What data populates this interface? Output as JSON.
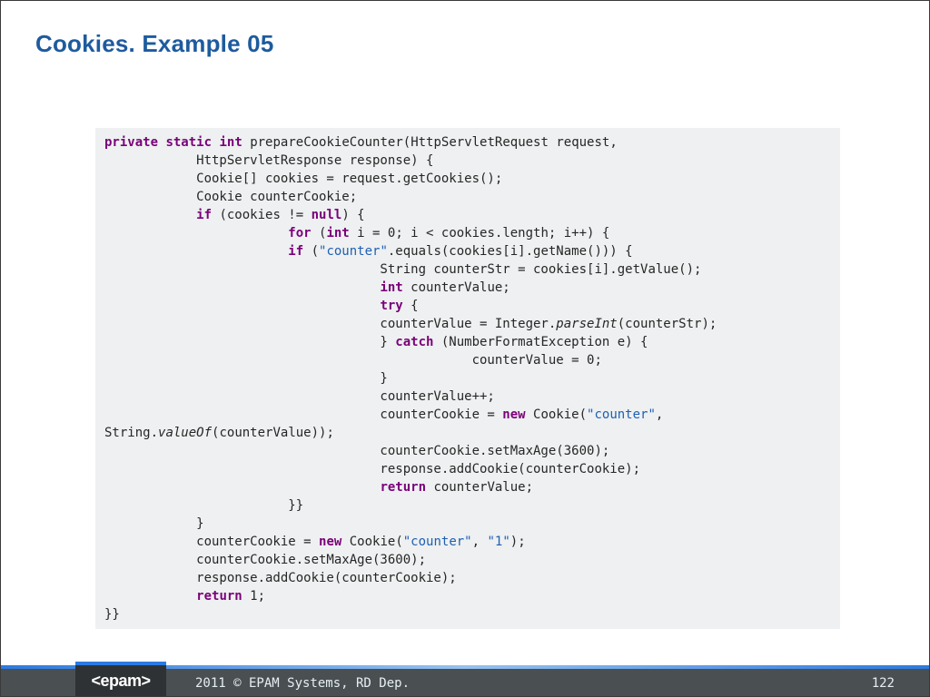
{
  "title": "Cookies. Example 05",
  "code": {
    "lines": [
      [
        [
          "private",
          "kw"
        ],
        [
          " ",
          ""
        ],
        [
          "static",
          "kw"
        ],
        [
          " ",
          ""
        ],
        [
          "int",
          "kw"
        ],
        [
          " prepareCookieCounter(HttpServletRequest request,",
          ""
        ]
      ],
      [
        [
          "            HttpServletResponse response) {",
          ""
        ]
      ],
      [
        [
          "            Cookie[] cookies = request.getCookies();",
          ""
        ]
      ],
      [
        [
          "            Cookie counterCookie;",
          ""
        ]
      ],
      [
        [
          "            ",
          ""
        ],
        [
          "if",
          "kw"
        ],
        [
          " (cookies != ",
          ""
        ],
        [
          "null",
          "kw"
        ],
        [
          ") {",
          ""
        ]
      ],
      [
        [
          "                        ",
          ""
        ],
        [
          "for",
          "kw"
        ],
        [
          " (",
          ""
        ],
        [
          "int",
          "kw"
        ],
        [
          " i = 0; i < cookies.length; i++) {",
          ""
        ]
      ],
      [
        [
          "                        ",
          ""
        ],
        [
          "if",
          "kw"
        ],
        [
          " (",
          ""
        ],
        [
          "\"counter\"",
          "str"
        ],
        [
          ".equals(cookies[i].getName())) {",
          ""
        ]
      ],
      [
        [
          "                                    String counterStr = cookies[i].getValue();",
          ""
        ]
      ],
      [
        [
          "                                    ",
          ""
        ],
        [
          "int",
          "kw"
        ],
        [
          " counterValue;",
          ""
        ]
      ],
      [
        [
          "                                    ",
          ""
        ],
        [
          "try",
          "kw"
        ],
        [
          " {",
          ""
        ]
      ],
      [
        [
          "                                    counterValue = Integer.",
          ""
        ],
        [
          "parseInt",
          "ital"
        ],
        [
          "(counterStr);",
          ""
        ]
      ],
      [
        [
          "                                    } ",
          ""
        ],
        [
          "catch",
          "kw"
        ],
        [
          " (NumberFormatException e) {",
          ""
        ]
      ],
      [
        [
          "                                                counterValue = 0;",
          ""
        ]
      ],
      [
        [
          "                                    }",
          ""
        ]
      ],
      [
        [
          "                                    counterValue++;",
          ""
        ]
      ],
      [
        [
          "                                    counterCookie = ",
          ""
        ],
        [
          "new",
          "kw"
        ],
        [
          " Cookie(",
          ""
        ],
        [
          "\"counter\"",
          "str"
        ],
        [
          ",",
          ""
        ]
      ],
      [
        [
          "String.",
          ""
        ],
        [
          "valueOf",
          "ital"
        ],
        [
          "(counterValue));",
          ""
        ]
      ],
      [
        [
          "                                    counterCookie.setMaxAge(3600);",
          ""
        ]
      ],
      [
        [
          "                                    response.addCookie(counterCookie);",
          ""
        ]
      ],
      [
        [
          "                                    ",
          ""
        ],
        [
          "return",
          "kw"
        ],
        [
          " counterValue;",
          ""
        ]
      ],
      [
        [
          "                        }}",
          ""
        ]
      ],
      [
        [
          "            }",
          ""
        ]
      ],
      [
        [
          "            counterCookie = ",
          ""
        ],
        [
          "new",
          "kw"
        ],
        [
          " Cookie(",
          ""
        ],
        [
          "\"counter\"",
          "str"
        ],
        [
          ", ",
          ""
        ],
        [
          "\"1\"",
          "str"
        ],
        [
          ");",
          ""
        ]
      ],
      [
        [
          "            counterCookie.setMaxAge(3600);",
          ""
        ]
      ],
      [
        [
          "            response.addCookie(counterCookie);",
          ""
        ]
      ],
      [
        [
          "            ",
          ""
        ],
        [
          "return",
          "kw"
        ],
        [
          " 1;",
          ""
        ]
      ],
      [
        [
          "}}",
          ""
        ]
      ]
    ]
  },
  "footer": {
    "logo": "<epam>",
    "copyright": "2011 © EPAM Systems, RD Dep.",
    "page": "122"
  }
}
